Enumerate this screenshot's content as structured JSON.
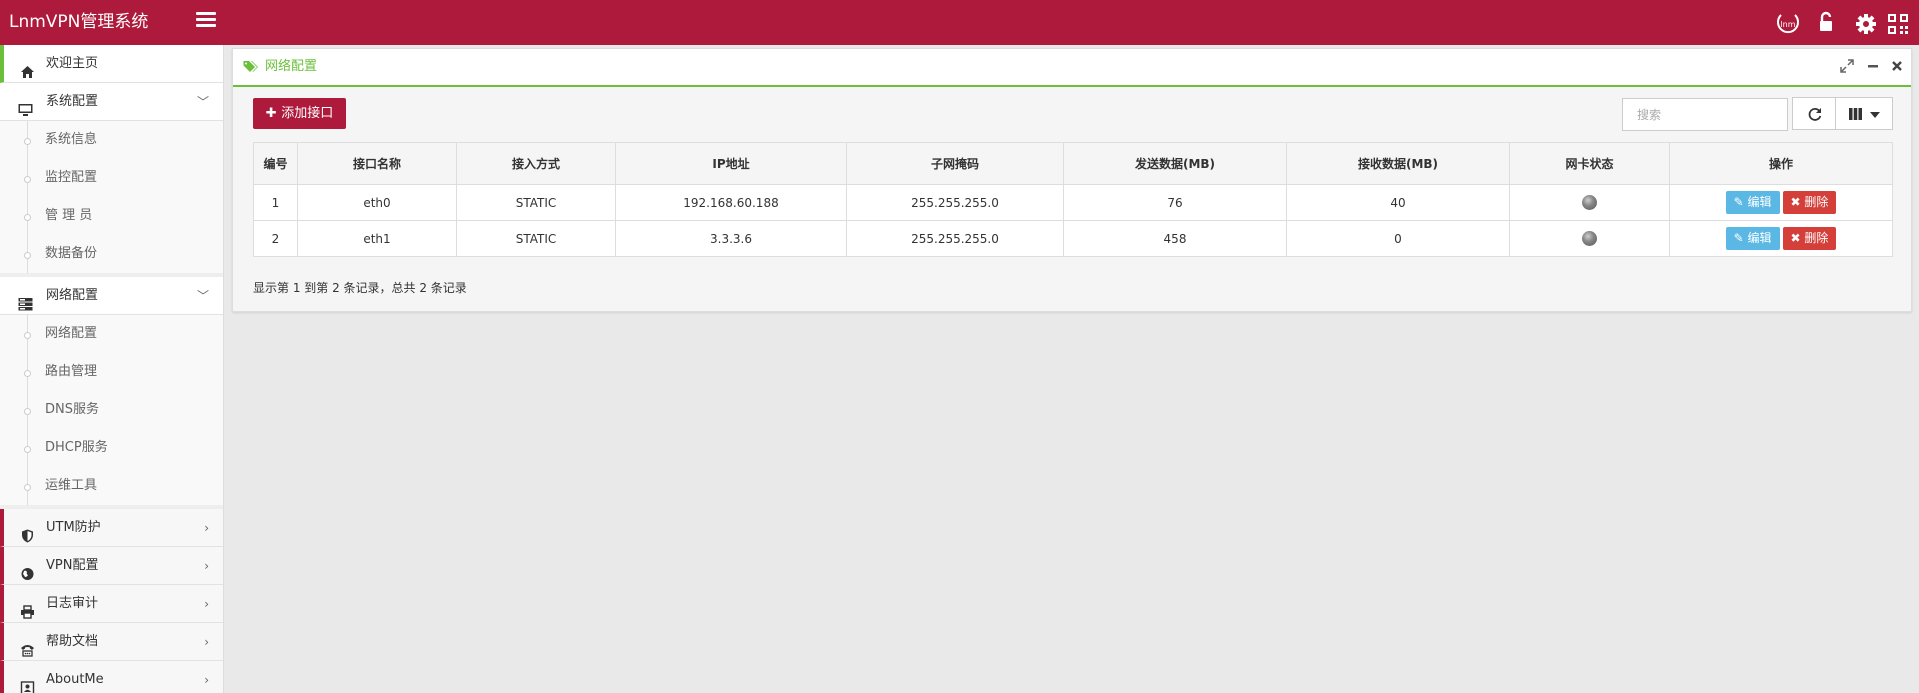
{
  "app": {
    "title": "LnmVPN管理系统",
    "accent": "#ad1a3b",
    "success": "#6bbf3b"
  },
  "topbar": {
    "icons": [
      "lnm-logo-icon",
      "unlock-icon",
      "gear-icon",
      "qrcode-icon"
    ],
    "lnm_text": "lnm"
  },
  "sidebar": {
    "home": "欢迎主页",
    "system": {
      "label": "系统配置",
      "items": [
        "系统信息",
        "监控配置",
        "管 理 员",
        "数据备份"
      ]
    },
    "network": {
      "label": "网络配置",
      "items": [
        "网络配置",
        "路由管理",
        "DNS服务",
        "DHCP服务",
        "运维工具"
      ]
    },
    "collapsed": [
      "UTM防护",
      "VPN配置",
      "日志审计",
      "帮助文档",
      "AboutMe"
    ]
  },
  "widget": {
    "title": "网络配置",
    "add_button": "添加接口",
    "search_placeholder": "搜索",
    "columns": [
      "编号",
      "接口名称",
      "接入方式",
      "IP地址",
      "子网掩码",
      "发送数据(MB)",
      "接收数据(MB)",
      "网卡状态",
      "操作"
    ],
    "rows": [
      {
        "id": "1",
        "name": "eth0",
        "mode": "STATIC",
        "ip": "192.168.60.188",
        "mask": "255.255.255.0",
        "tx": "76",
        "rx": "40"
      },
      {
        "id": "2",
        "name": "eth1",
        "mode": "STATIC",
        "ip": "3.3.3.6",
        "mask": "255.255.255.0",
        "tx": "458",
        "rx": "0"
      }
    ],
    "edit_label": "编辑",
    "delete_label": "删除",
    "pager": "显示第 1 到第 2 条记录，总共 2 条记录"
  }
}
